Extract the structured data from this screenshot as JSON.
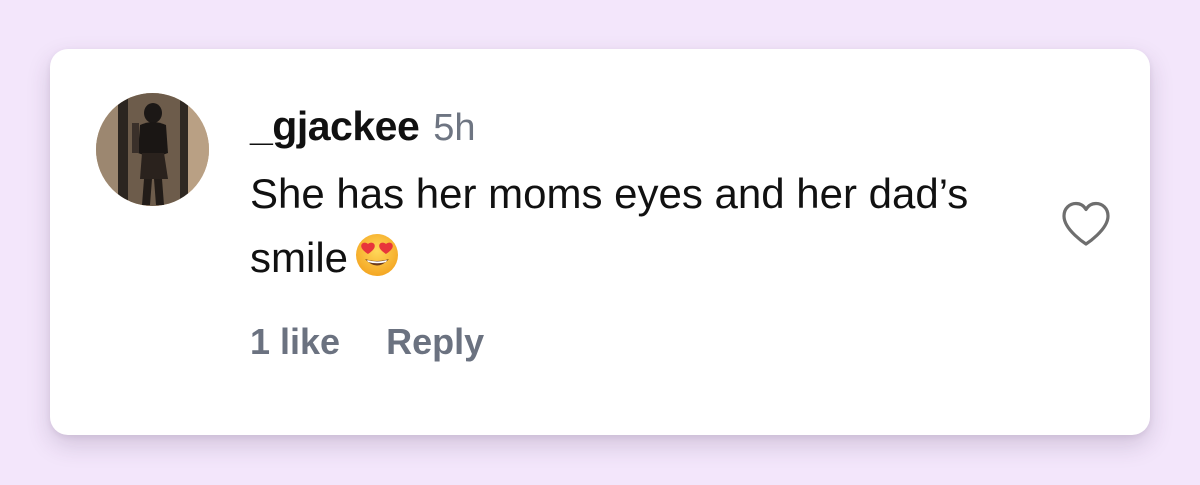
{
  "comment": {
    "username": "_gjackee",
    "timestamp": "5h",
    "text": "She has her moms eyes and her dad’s smile",
    "emoji": "heart-eyes-emoji",
    "like_count_label": "1 like",
    "reply_label": "Reply",
    "like_icon": "heart-outline-icon"
  },
  "colors": {
    "page_background": "#f3e6fb",
    "card_background": "#ffffff",
    "text_primary": "#111111",
    "text_secondary": "#6b7280"
  }
}
